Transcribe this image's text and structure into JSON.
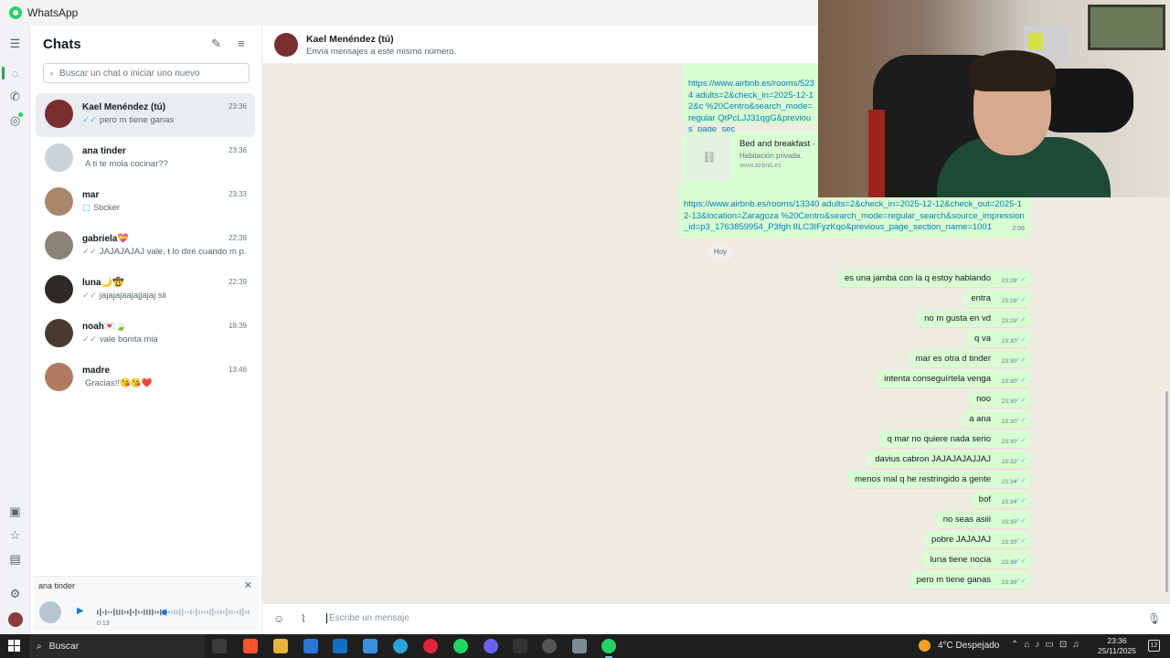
{
  "window": {
    "title": "WhatsApp"
  },
  "sidebar": {
    "title": "Chats",
    "search_placeholder": "Buscar un chat o iniciar uno nuevo",
    "chats": [
      {
        "name": "Kael Menéndez (tú)",
        "time": "23:36",
        "preview": "pero m tiene ganas",
        "tick": "✓✓",
        "tick_color": "blue",
        "avatar_color": "#7a2f2f",
        "active": true
      },
      {
        "name": "ana tinder",
        "time": "23:36",
        "preview": "A ti te mola cocinar??",
        "tick": "",
        "avatar_color": "#c9d3dc"
      },
      {
        "name": "mar",
        "time": "23:33",
        "preview": "Sticker",
        "tick": "▢",
        "avatar_color": "#a9876b"
      },
      {
        "name": "gabriela💝",
        "time": "22:39",
        "preview": "JAJAJAJAJ vale, t lo diré cuando m p...",
        "tick": "✓✓",
        "tick_color": "grey",
        "avatar_color": "#8c8275"
      },
      {
        "name": "luna🌙🤠",
        "time": "22:39",
        "preview": "jajajajaajajjajaj sii",
        "tick": "✓✓",
        "tick_color": "grey",
        "avatar_color": "#2e2a26"
      },
      {
        "name": "noah💌🍃",
        "time": "18:39",
        "preview": "vale bonita mia",
        "tick": "✓✓",
        "tick_color": "grey",
        "avatar_color": "#4a3a30"
      },
      {
        "name": "madre",
        "time": "13:46",
        "preview": "Gracias!!😘😘❤️",
        "tick": "",
        "avatar_color": "#b07a60"
      }
    ]
  },
  "player": {
    "name": "ana tinder",
    "time": "0:13",
    "progress": 0.44
  },
  "conversation": {
    "name": "Kael Menéndez (tú)",
    "subtitle": "Envía mensajes a este mismo número.",
    "link1_text": "https://www.airbnb.es/rooms/5234 adults=2&check_in=2025-12-12&c %20Centro&search_mode=regular QtPcLJJ31qgG&previous_page_sec",
    "link_card": {
      "title": "Bed and breakfast · Z",
      "subtitle": "Habitación privada.",
      "domain": "www.airbnb.es"
    },
    "link2_text": "https://www.airbnb.es/rooms/13340 adults=2&check_in=2025-12-12&check_out=2025-12-13&location=Zaragoza %20Centro&search_mode=regular_search&source_impression_id=p3_1763859954_P3fgh 8LC3IFyzKqo&previous_page_section_name=1001",
    "link2_time": "2:06",
    "day_label": "Hoy",
    "messages": [
      {
        "text": "es una jamba con la q estoy hablando",
        "time": "23:28"
      },
      {
        "text": "entra",
        "time": "23:28"
      },
      {
        "text": "no m gusta en vd",
        "time": "23:29"
      },
      {
        "text": "q va",
        "time": "23:30"
      },
      {
        "text": "mar es otra d tinder",
        "time": "23:30"
      },
      {
        "text": "intenta conseguírtela venga",
        "time": "23:30"
      },
      {
        "text": "noo",
        "time": "23:30"
      },
      {
        "text": "a ana",
        "time": "23:30"
      },
      {
        "text": "q mar no quiere nada serio",
        "time": "23:30"
      },
      {
        "text": "davius cabron JAJAJAJAJJAJ",
        "time": "23:32"
      },
      {
        "text": "menos mal q he restringido a gente",
        "time": "23:34"
      },
      {
        "text": "bof",
        "time": "23:34"
      },
      {
        "text": "no seas asiii",
        "time": "23:35"
      },
      {
        "text": "pobre JAJAJAJ",
        "time": "23:35"
      },
      {
        "text": "luna tiene nocia",
        "time": "23:36"
      },
      {
        "text": "pero m tiene ganas",
        "time": "23:36"
      }
    ],
    "composer_placeholder": "Escribe un mensaje"
  },
  "taskbar": {
    "search_label": "Buscar",
    "weather": "4°C  Despejado",
    "time": "23:36",
    "date": "25/11/2025",
    "notif_count": "12"
  },
  "colors": {
    "accent": "#25d366",
    "bubble": "#d9fdd3",
    "chat_bg": "#efeae2",
    "tick_blue": "#53bdeb"
  }
}
